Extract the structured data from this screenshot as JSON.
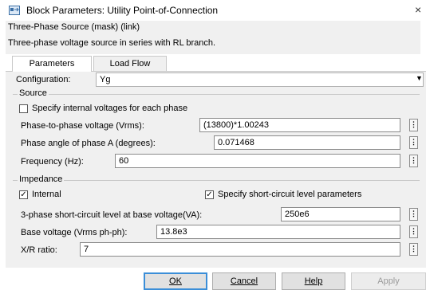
{
  "window": {
    "title": "Block Parameters: Utility Point-of-Connection",
    "close_glyph": "×",
    "icon": "simulink-block-icon"
  },
  "header": {
    "mask_title": "Three-Phase Source (mask) (link)",
    "description": "Three-phase voltage source in series with RL branch."
  },
  "tabs": [
    {
      "label": "Parameters",
      "active": true
    },
    {
      "label": "Load Flow",
      "active": false
    }
  ],
  "configuration": {
    "label": "Configuration:",
    "value": "Yg"
  },
  "source": {
    "group_label": "Source",
    "specify_internal": {
      "label": "Specify internal voltages for each phase",
      "checked": false
    },
    "fields": [
      {
        "label": "Phase-to-phase voltage (Vrms):",
        "value": "(13800)*1.00243"
      },
      {
        "label": "Phase angle of phase A (degrees):",
        "value": "0.071468"
      },
      {
        "label": "Frequency (Hz):",
        "value": "60"
      }
    ]
  },
  "impedance": {
    "group_label": "Impedance",
    "internal": {
      "label": "Internal",
      "checked": true
    },
    "specify_short_circuit": {
      "label": "Specify short-circuit level parameters",
      "checked": true
    },
    "fields": [
      {
        "label": "3-phase short-circuit level at base voltage(VA):",
        "value": "250e6"
      },
      {
        "label": "Base voltage (Vrms ph-ph):",
        "value": "13.8e3"
      },
      {
        "label": "X/R ratio:",
        "value": "7"
      }
    ]
  },
  "buttons": {
    "ok": "OK",
    "cancel": "Cancel",
    "help": "Help",
    "apply": "Apply"
  },
  "colors": {
    "panel_bg": "#f0f0f0",
    "ok_focus_border": "#3b8ed8",
    "disabled_text": "#9a9a9a"
  }
}
